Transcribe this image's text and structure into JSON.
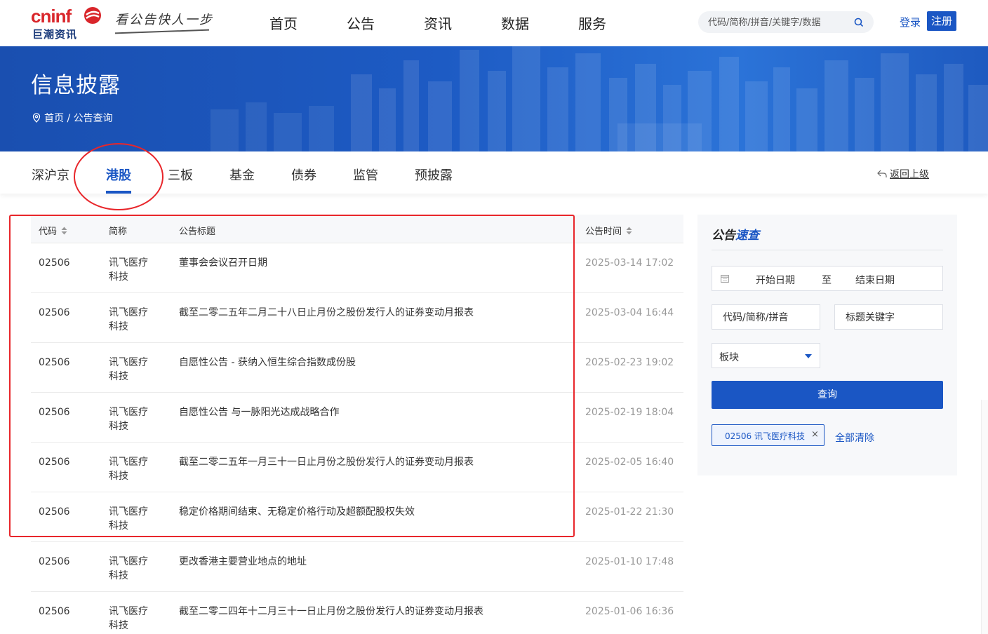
{
  "header": {
    "logo_en": "cninf",
    "logo_cn": "巨潮资讯",
    "slogan": "看公告快人一步",
    "nav": [
      "首页",
      "公告",
      "资讯",
      "数据",
      "服务"
    ],
    "search_placeholder": "代码/简称/拼音/关键字/数据",
    "login": "登录",
    "register": "注册"
  },
  "banner": {
    "title": "信息披露",
    "breadcrumb": "首页 / 公告查询"
  },
  "tabs": {
    "items": [
      "深沪京",
      "港股",
      "三板",
      "基金",
      "债券",
      "监管",
      "预披露"
    ],
    "active": "港股",
    "back": "返回上级"
  },
  "table": {
    "headers": {
      "code": "代码",
      "abbr": "简称",
      "title": "公告标题",
      "time": "公告时间"
    },
    "rows": [
      {
        "code": "02506",
        "abbr": "讯飞医疗科技",
        "title": "董事会会议召开日期",
        "time": "2025-03-14 17:02"
      },
      {
        "code": "02506",
        "abbr": "讯飞医疗科技",
        "title": "截至二零二五年二月二十八日止月份之股份发行人的证券变动月报表",
        "time": "2025-03-04 16:44"
      },
      {
        "code": "02506",
        "abbr": "讯飞医疗科技",
        "title": "自愿性公告 - 获纳入恒生综合指数成份股",
        "time": "2025-02-23 19:02"
      },
      {
        "code": "02506",
        "abbr": "讯飞医疗科技",
        "title": "自愿性公告 与一脉阳光达成战略合作",
        "time": "2025-02-19 18:04"
      },
      {
        "code": "02506",
        "abbr": "讯飞医疗科技",
        "title": "截至二零二五年一月三十一日止月份之股份发行人的证券变动月报表",
        "time": "2025-02-05 16:40"
      },
      {
        "code": "02506",
        "abbr": "讯飞医疗科技",
        "title": "稳定价格期间结束、无稳定价格行动及超额配股权失效",
        "time": "2025-01-22 21:30"
      },
      {
        "code": "02506",
        "abbr": "讯飞医疗科技",
        "title": "更改香港主要营业地点的地址",
        "time": "2025-01-10 17:48"
      },
      {
        "code": "02506",
        "abbr": "讯飞医疗科技",
        "title": "截至二零二四年十二月三十一日止月份之股份发行人的证券变动月报表",
        "time": "2025-01-06 16:36"
      }
    ]
  },
  "panel": {
    "title_a": "公告",
    "title_b": "速查",
    "date_start": "开始日期",
    "date_sep": "至",
    "date_end": "结束日期",
    "code_placeholder": "代码/简称/拼音",
    "keyword_placeholder": "标题关键字",
    "board_label": "板块",
    "query_button": "查询",
    "chip": "02506 讯飞医疗科技",
    "chip_close": "×",
    "clear_all": "全部清除"
  },
  "colors": {
    "brand_blue": "#1a56c4",
    "logo_red": "#d9262b",
    "annotation_red": "#e8262b"
  }
}
